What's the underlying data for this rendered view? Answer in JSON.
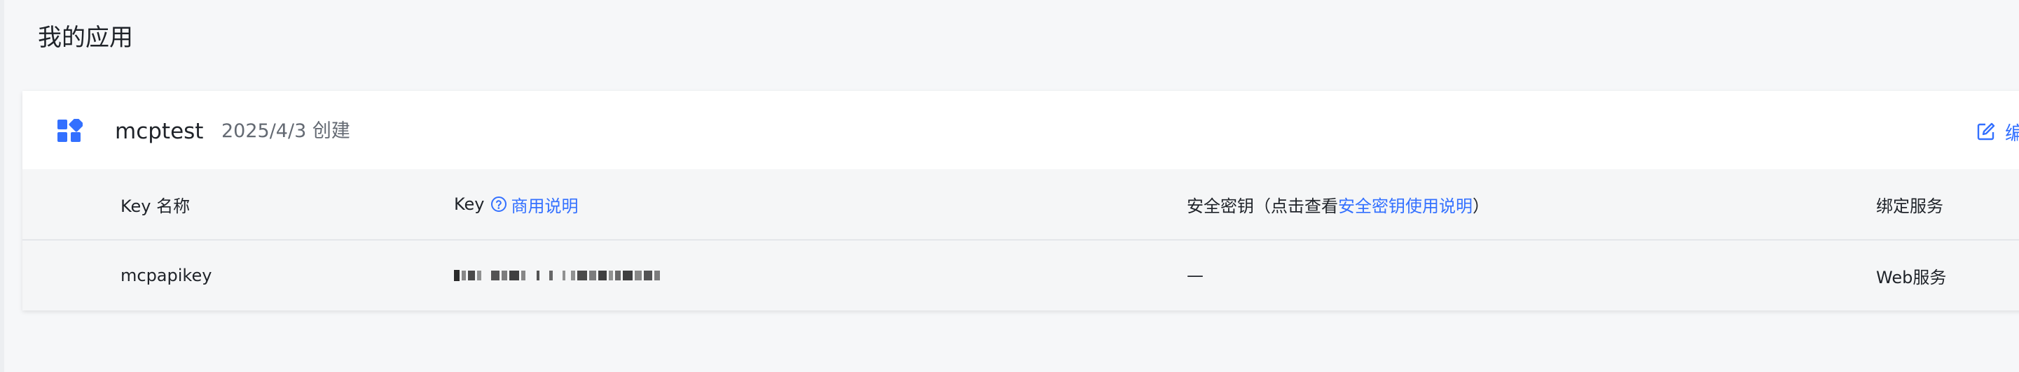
{
  "page": {
    "title": "我的应用"
  },
  "app": {
    "name": "mcptest",
    "created": "2025/4/3 创建",
    "edit_label": "编"
  },
  "table": {
    "columns": {
      "key_name": "Key 名称",
      "key": "Key",
      "key_help_link": "商用说明",
      "secret_prefix": "安全密钥（点击查看",
      "secret_link": "安全密钥使用说明",
      "secret_suffix": "）",
      "bound_service": "绑定服务"
    },
    "rows": [
      {
        "key_name": "mcpapikey",
        "secret": "—",
        "bound_service": "Web服务"
      }
    ]
  },
  "colors": {
    "accent": "#3370ff",
    "background": "#f6f7f9",
    "header_bg": "#f5f6f7"
  },
  "icons": {
    "app": "app-grid-icon",
    "edit": "edit-icon",
    "help": "help-circle-icon"
  }
}
